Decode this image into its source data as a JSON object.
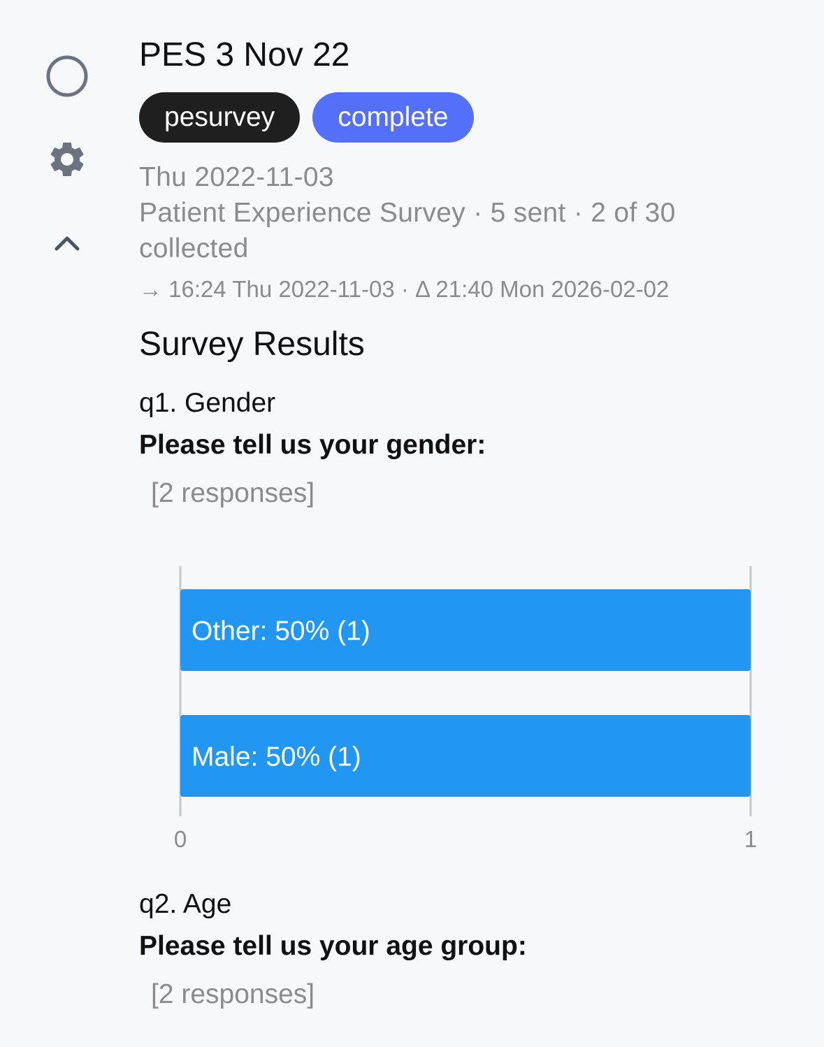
{
  "sidebar": {
    "icons": [
      "circle-icon",
      "gear-icon",
      "chevron-up-icon"
    ]
  },
  "survey": {
    "title": "PES 3 Nov 22",
    "badges": [
      {
        "label": "pesurvey",
        "color": "#1f1f1f"
      },
      {
        "label": "complete",
        "color": "#5470fa"
      }
    ],
    "date": "Thu 2022-11-03",
    "summary": "Patient Experience Survey · 5 sent · 2 of 30 collected",
    "timing": "→ 16:24 Thu 2022-11-03 · Δ 21:40 Mon 2026-02-02"
  },
  "results": {
    "heading": "Survey Results",
    "questions": [
      {
        "label": "q1. Gender",
        "text": "Please tell us your gender:",
        "responses": "[2 responses]"
      },
      {
        "label": "q2. Age",
        "text": "Please tell us your age group:",
        "responses": "[2 responses]"
      }
    ]
  },
  "chart_data": {
    "type": "bar",
    "orientation": "horizontal",
    "categories": [
      "Other",
      "Male"
    ],
    "values": [
      1,
      1
    ],
    "percent": [
      50,
      50
    ],
    "bar_labels": [
      "Other: 50% (1)",
      "Male: 50% (1)"
    ],
    "xlim": [
      0,
      1
    ],
    "x_ticks": [
      "0",
      "1"
    ],
    "bar_color": "#2196f3",
    "grid": false
  }
}
